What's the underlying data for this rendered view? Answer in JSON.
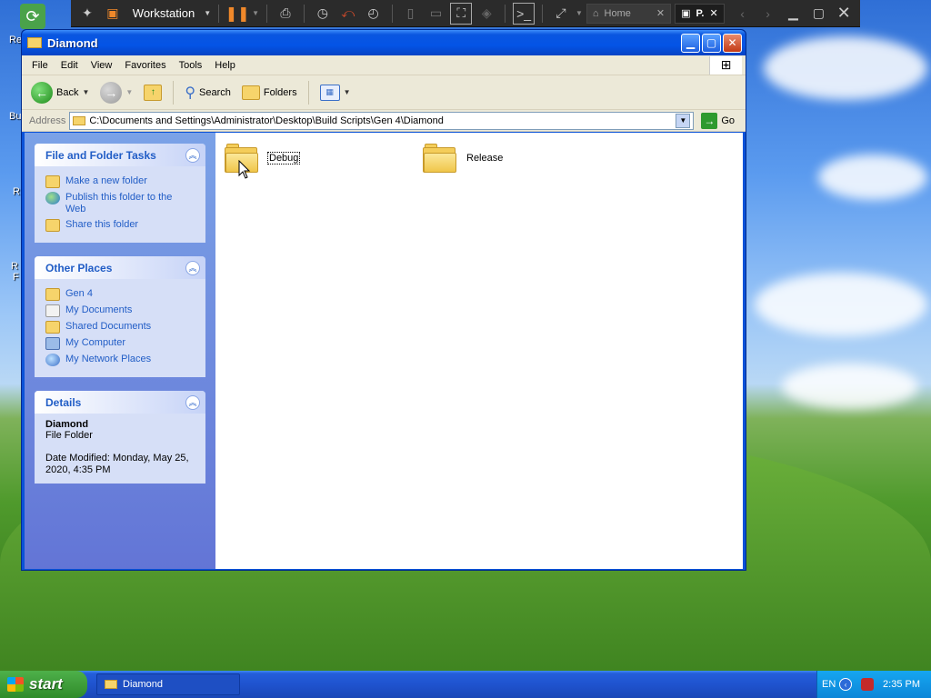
{
  "vm": {
    "title": "Workstation",
    "tabs": [
      {
        "label": "Home"
      },
      {
        "label": "P."
      }
    ]
  },
  "window": {
    "title": "Diamond",
    "menu": [
      "File",
      "Edit",
      "View",
      "Favorites",
      "Tools",
      "Help"
    ],
    "toolbar": {
      "back": "Back",
      "search": "Search",
      "folders": "Folders"
    },
    "address": {
      "label": "Address",
      "path": "C:\\Documents and Settings\\Administrator\\Desktop\\Build Scripts\\Gen 4\\Diamond",
      "go": "Go"
    }
  },
  "taskpane": {
    "file_folder_tasks": {
      "title": "File and Folder Tasks",
      "items": [
        "Make a new folder",
        "Publish this folder to the Web",
        "Share this folder"
      ]
    },
    "other_places": {
      "title": "Other Places",
      "items": [
        "Gen 4",
        "My Documents",
        "Shared Documents",
        "My Computer",
        "My Network Places"
      ]
    },
    "details": {
      "title": "Details",
      "name": "Diamond",
      "type": "File Folder",
      "date_modified": "Date Modified: Monday, May 25, 2020, 4:35 PM"
    }
  },
  "content": {
    "items": [
      {
        "label": "Debug"
      },
      {
        "label": "Release"
      }
    ]
  },
  "taskbar": {
    "start": "start",
    "task": "Diamond",
    "lang": "EN",
    "clock": "2:35 PM"
  },
  "desktop": {
    "fragments": [
      "Re",
      "Bu",
      "R",
      "R",
      "F"
    ]
  }
}
